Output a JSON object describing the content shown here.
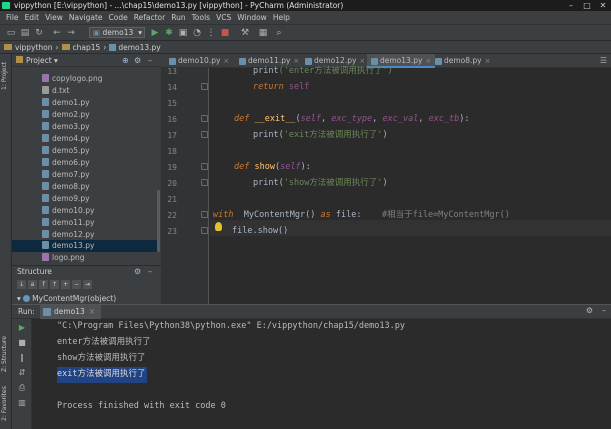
{
  "window": {
    "title": "vippython [E:\\vippython] - ...\\chap15\\demo13.py [vippython] - PyCharm (Administrator)",
    "controls": [
      "–",
      "□",
      "✕"
    ]
  },
  "menu": [
    "File",
    "Edit",
    "View",
    "Navigate",
    "Code",
    "Refactor",
    "Run",
    "Tools",
    "VCS",
    "Window",
    "Help"
  ],
  "toolbar": {
    "run_config": "demo13"
  },
  "breadcrumb": [
    "vippython",
    "chap15",
    "demo13.py"
  ],
  "side_tabs": {
    "project": "1: Project",
    "structure": "Z: Structure",
    "favorites": "2: Favorites"
  },
  "project": {
    "title": "Project",
    "files": [
      "copylogo.png",
      "d.txt",
      "demo1.py",
      "demo2.py",
      "demo3.py",
      "demo4.py",
      "demo5.py",
      "demo6.py",
      "demo7.py",
      "demo8.py",
      "demo9.py",
      "demo10.py",
      "demo11.py",
      "demo12.py",
      "demo13.py",
      "logo.png"
    ],
    "selected": "demo13.py"
  },
  "structure": {
    "title": "Structure",
    "item": "MyContentMgr(object)"
  },
  "editor": {
    "tabs": [
      "demo10.py",
      "demo11.py",
      "demo12.py",
      "demo13.py",
      "demo8.py"
    ],
    "active_tab": "demo13.py",
    "line_numbers": [
      "13",
      "14",
      "15",
      "16",
      "17",
      "18",
      "19",
      "20",
      "21",
      "22",
      "23"
    ],
    "code": {
      "l13_print": "print",
      "l13_str": "('enter方法被调用执行了')",
      "l14_kw": "return",
      "l14_self": "self",
      "l16_def": "def",
      "l16_fn": "__exit__",
      "l16_p1": "self",
      "l16_p2": "exc_type",
      "l16_p3": "exc_val",
      "l16_p4": "exc_tb",
      "l17_print": "print",
      "l17_str": "'exit方法被调用执行了'",
      "l19_def": "def",
      "l19_fn": "show",
      "l19_p1": "self",
      "l20_print": "print",
      "l20_str": "'show方法被调用执行了'",
      "l22_with": "with",
      "l22_cls": "MyContentMgr",
      "l22_as": "as",
      "l22_var": "file",
      "l22_comment": "#相当于file=MyContentMgr()",
      "l23_code": "file.show()"
    }
  },
  "run": {
    "label": "Run:",
    "tab": "demo13",
    "console": [
      "\"C:\\Program Files\\Python38\\python.exe\" E:/vippython/chap15/demo13.py",
      "enter方法被调用执行了",
      "show方法被调用执行了",
      "exit方法被调用执行了",
      "",
      "Process finished with exit code 0"
    ]
  }
}
